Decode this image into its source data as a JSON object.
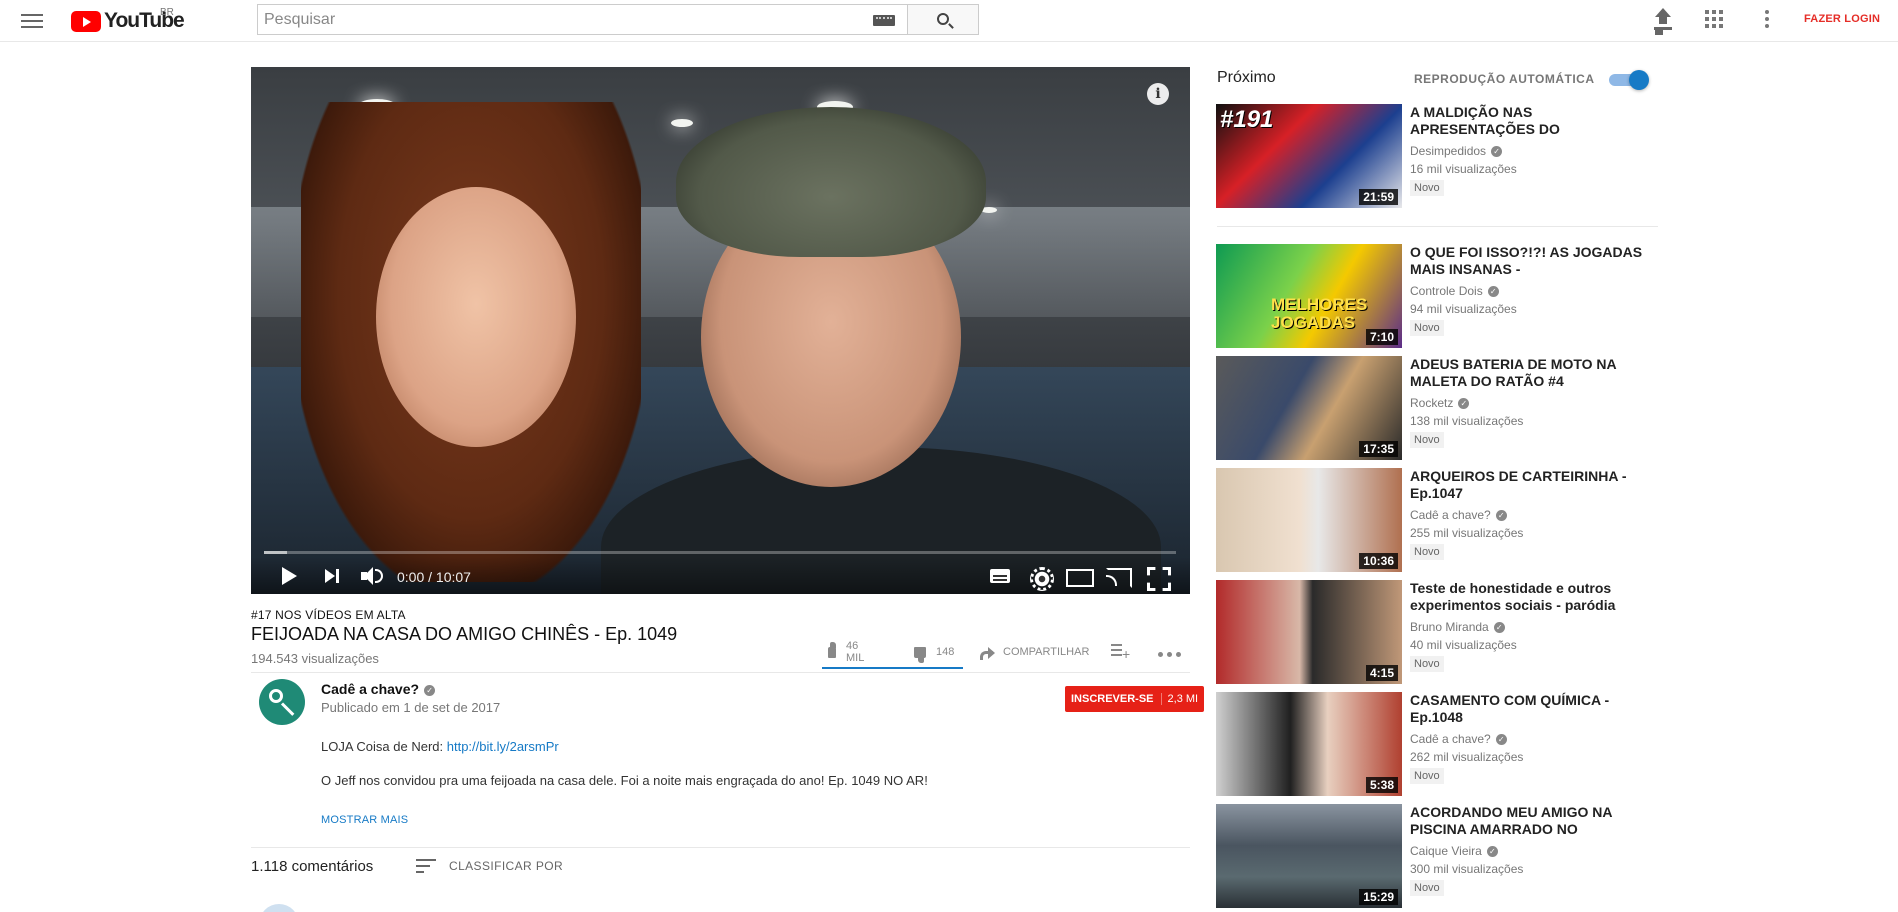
{
  "header": {
    "logo_text": "YouTube",
    "logo_country": "BR",
    "search_placeholder": "Pesquisar",
    "login_label": "FAZER LOGIN"
  },
  "player": {
    "time": "0:00 / 10:07",
    "info_label": "i",
    "buffered_fraction": 0.025
  },
  "video": {
    "trending": "#17 NOS VÍDEOS EM ALTA",
    "title": "FEIJOADA NA CASA DO AMIGO CHINÊS - Ep. 1049",
    "views": "194.543 visualizações",
    "likes": "46 MIL",
    "dislikes": "148",
    "like_fraction": 0.997,
    "share_label": "COMPARTILHAR"
  },
  "channel": {
    "name": "Cadê a chave?",
    "published": "Publicado em 1 de set de 2017",
    "subscribe_label": "INSCREVER-SE",
    "subscribers": "2,3 MI"
  },
  "description": {
    "line1_prefix": "LOJA Coisa de Nerd: ",
    "line1_link": "http://bit.ly/2arsmPr",
    "line2": "O Jeff nos convidou pra uma feijoada na casa dele. Foi a noite mais engraçada do ano! Ep. 1049 NO AR!",
    "show_more": "MOSTRAR MAIS"
  },
  "comments": {
    "count": "1.118 comentários",
    "sort_label": "CLASSIFICAR POR"
  },
  "sidebar": {
    "up_next": "Próximo",
    "autoplay_label": "REPRODUÇÃO AUTOMÁTICA",
    "autoplay_on": true,
    "recs": [
      {
        "title": "A MALDIÇÃO NAS APRESENTAÇÕES DO",
        "channel": "Desimpedidos",
        "views": "16 mil visualizações",
        "badge": "Novo",
        "duration": "21:59",
        "thumb_text": "#191"
      },
      {
        "title": "O QUE FOI ISSO?!?! AS JOGADAS MAIS INSANAS -",
        "channel": "Controle Dois",
        "views": "94 mil visualizações",
        "badge": "Novo",
        "duration": "7:10",
        "thumb_text": "MELHORES JOGADAS"
      },
      {
        "title": "ADEUS BATERIA DE MOTO NA MALETA DO RATÃO #4",
        "channel": "Rocketz",
        "views": "138 mil visualizações",
        "badge": "Novo",
        "duration": "17:35"
      },
      {
        "title": "ARQUEIROS DE CARTEIRINHA - Ep.1047",
        "channel": "Cadê a chave?",
        "views": "255 mil visualizações",
        "badge": "Novo",
        "duration": "10:36"
      },
      {
        "title": "Teste de honestidade e outros experimentos sociais - paródia",
        "channel": "Bruno Miranda",
        "views": "40 mil visualizações",
        "badge": "Novo",
        "duration": "4:15"
      },
      {
        "title": "CASAMENTO COM QUÍMICA - Ep.1048",
        "channel": "Cadê a chave?",
        "views": "262 mil visualizações",
        "badge": "Novo",
        "duration": "5:38"
      },
      {
        "title": "ACORDANDO MEU AMIGO NA PISCINA AMARRADO NO",
        "channel": "Caique Vieira",
        "views": "300 mil visualizações",
        "badge": "Novo",
        "duration": "15:29"
      }
    ]
  },
  "colors": {
    "brand_red": "#ff0000",
    "subscribe_red": "#e62117",
    "link_blue": "#167ac6",
    "autoplay_blue": "#167ac6"
  }
}
